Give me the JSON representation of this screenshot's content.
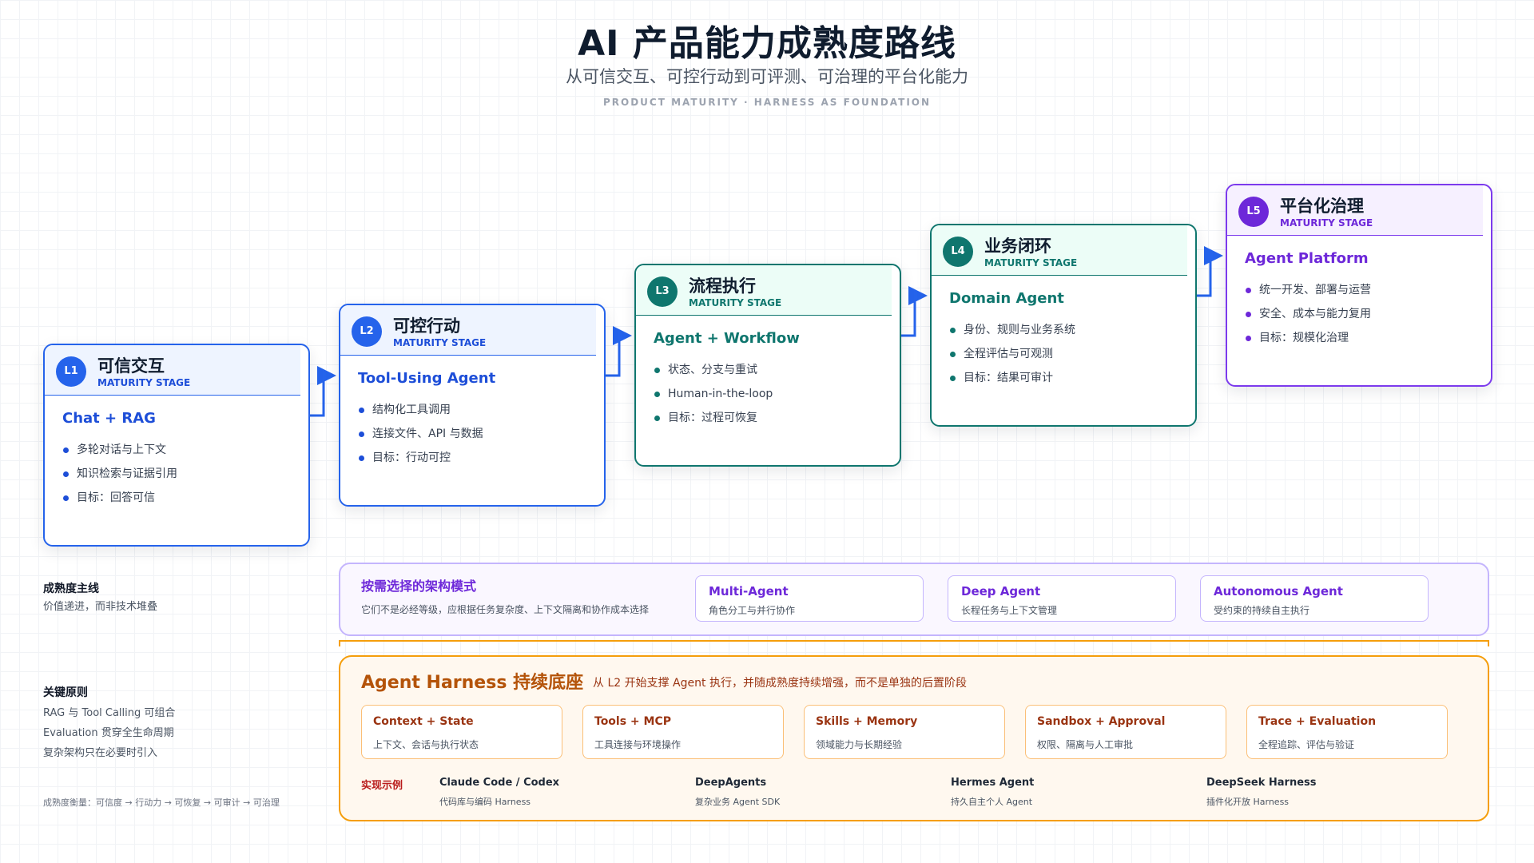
{
  "header": {
    "title": "AI 产品能力成熟度路线",
    "subtitle": "从可信交互、可控行动到可评测、可治理的平台化能力",
    "caption": "PRODUCT MATURITY · HARNESS AS FOUNDATION"
  },
  "stages": [
    {
      "level": "L1",
      "name": "可信交互",
      "tag": "MATURITY STAGE",
      "model": "Chat + RAG",
      "bullets": [
        "多轮对话与上下文",
        "知识检索与证据引用",
        "目标：回答可信"
      ]
    },
    {
      "level": "L2",
      "name": "可控行动",
      "tag": "MATURITY STAGE",
      "model": "Tool-Using Agent",
      "bullets": [
        "结构化工具调用",
        "连接文件、API 与数据",
        "目标：行动可控"
      ]
    },
    {
      "level": "L3",
      "name": "流程执行",
      "tag": "MATURITY STAGE",
      "model": "Agent + Workflow",
      "bullets": [
        "状态、分支与重试",
        "Human-in-the-loop",
        "目标：过程可恢复"
      ]
    },
    {
      "level": "L4",
      "name": "业务闭环",
      "tag": "MATURITY STAGE",
      "model": "Domain Agent",
      "bullets": [
        "身份、规则与业务系统",
        "全程评估与可观测",
        "目标：结果可审计"
      ]
    },
    {
      "level": "L5",
      "name": "平台化治理",
      "tag": "MATURITY STAGE",
      "model": "Agent Platform",
      "bullets": [
        "统一开发、部署与运营",
        "安全、成本与能力复用",
        "目标：规模化治理"
      ]
    }
  ],
  "sidebar": {
    "mainline_title": "成熟度主线",
    "mainline_text": "价值递进，而非技术堆叠",
    "principles_title": "关键原则",
    "principles": [
      "RAG 与 Tool Calling 可组合",
      "Evaluation 贯穿全生命周期",
      "复杂架构只在必要时引入"
    ],
    "measure": "成熟度衡量：可信度 → 行动力 → 可恢复 → 可审计 → 可治理"
  },
  "architecture": {
    "title": "按需选择的架构模式",
    "desc": "它们不是必经等级，应根据任务复杂度、上下文隔离和协作成本选择",
    "patterns": [
      {
        "name": "Multi-Agent",
        "desc": "角色分工与并行协作"
      },
      {
        "name": "Deep Agent",
        "desc": "长程任务与上下文管理"
      },
      {
        "name": "Autonomous Agent",
        "desc": "受约束的持续自主执行"
      }
    ]
  },
  "harness": {
    "title": "Agent Harness 持续底座",
    "desc": "从 L2 开始支撑 Agent 执行，并随成熟度持续增强，而不是单独的后置阶段",
    "components": [
      {
        "name": "Context + State",
        "desc": "上下文、会话与执行状态"
      },
      {
        "name": "Tools + MCP",
        "desc": "工具连接与环境操作"
      },
      {
        "name": "Skills + Memory",
        "desc": "领域能力与长期经验"
      },
      {
        "name": "Sandbox + Approval",
        "desc": "权限、隔离与人工审批"
      },
      {
        "name": "Trace + Evaluation",
        "desc": "全程追踪、评估与验证"
      }
    ],
    "examples_label": "实现示例",
    "examples": [
      {
        "name": "Claude Code / Codex",
        "desc": "代码库与编码 Harness"
      },
      {
        "name": "DeepAgents",
        "desc": "复杂业务 Agent SDK"
      },
      {
        "name": "Hermes Agent",
        "desc": "持久自主个人 Agent"
      },
      {
        "name": "DeepSeek Harness",
        "desc": "插件化开放 Harness"
      }
    ]
  },
  "colors": {
    "blue": "#2563eb",
    "green": "#0f766e",
    "purple": "#6d28d9",
    "orange": "#f59e0b",
    "title": "#0f1c2e"
  }
}
